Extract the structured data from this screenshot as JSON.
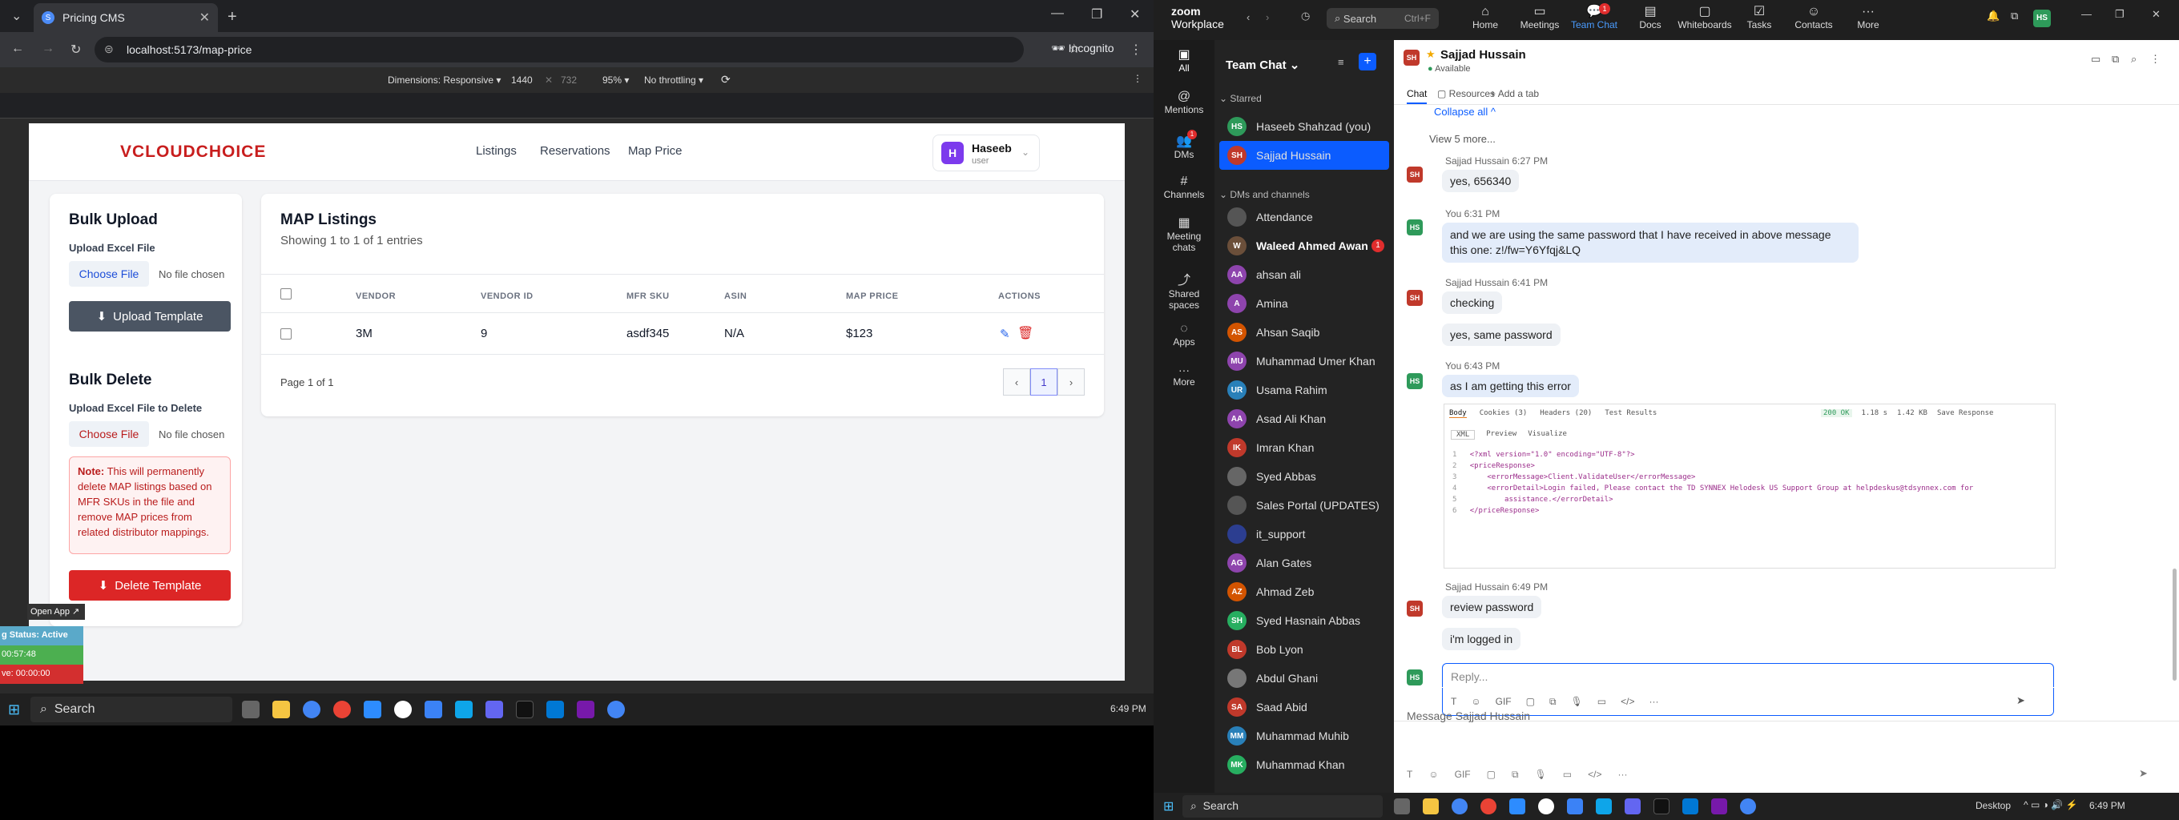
{
  "browser": {
    "tab_title": "Pricing CMS",
    "url": "localhost:5173/map-price",
    "incognito_label": "Incognito",
    "devtools": {
      "dimensions_label": "Dimensions: Responsive",
      "width": "1440",
      "height": "732",
      "zoom": "95%",
      "throttling": "No throttling"
    }
  },
  "app": {
    "logo_text": "CLOUDCHOICE",
    "nav": [
      "Listings",
      "Reservations",
      "Map Price"
    ],
    "user": {
      "initial": "H",
      "name": "Haseeb",
      "role": "user"
    },
    "bulk_upload": {
      "title": "Bulk Upload",
      "label": "Upload Excel File",
      "choose_label": "Choose File",
      "no_file": "No file chosen",
      "button": "Upload Template"
    },
    "bulk_delete": {
      "title": "Bulk Delete",
      "label": "Upload Excel File to Delete",
      "choose_label": "Choose File",
      "no_file": "No file chosen",
      "note_strong": "Note:",
      "note_text": " This will permanently delete MAP listings based on MFR SKUs in the file and remove MAP prices from related distributor mappings.",
      "button": "Delete Template"
    },
    "listings": {
      "title": "MAP Listings",
      "subtitle": "Showing 1 to 1 of 1 entries",
      "columns": [
        "VENDOR",
        "VENDOR ID",
        "MFR SKU",
        "ASIN",
        "MAP PRICE",
        "ACTIONS"
      ],
      "rows": [
        {
          "vendor": "3M",
          "vendor_id": "9",
          "mfr_sku": "asdf345",
          "asin": "N/A",
          "map_price": "$123"
        }
      ],
      "page_info": "Page 1 of 1",
      "current_page": "1"
    }
  },
  "widget": {
    "open_app": "Open App ↗",
    "status": "g Status: Active",
    "timer": "00:57:48",
    "ive": "ve: 00:00:00"
  },
  "taskbar_left": {
    "search": "Search",
    "time": "6:49 PM"
  },
  "zoom": {
    "brand_top": "zoom",
    "brand_bottom": "Workplace",
    "search": "Search",
    "shortcut": "Ctrl+F",
    "menu": [
      "Home",
      "Meetings",
      "Team Chat",
      "Docs",
      "Whiteboards",
      "Tasks",
      "Contacts",
      "More"
    ],
    "team_chat_badge": "1",
    "my_initials": "HS",
    "rail": [
      "All",
      "Mentions",
      "DMs",
      "Channels",
      "Meeting chats",
      "Shared spaces",
      "Apps",
      "More"
    ],
    "dms_badge": "1",
    "sidebar_title": "Team Chat",
    "starred_label": "Starred",
    "starred": [
      {
        "initials": "HS",
        "name": "Haseeb Shahzad (you)",
        "color": "#2e9a5a"
      },
      {
        "initials": "SH",
        "name": "Sajjad Hussain",
        "color": "#c0392b",
        "selected": true
      }
    ],
    "dms_label": "DMs and channels",
    "dms": [
      {
        "initials": "",
        "name": "Attendance",
        "color": "#555"
      },
      {
        "initials": "W",
        "name": "Waleed Ahmed Awan",
        "color": "#6b4f3a",
        "bold": true,
        "badge": "1"
      },
      {
        "initials": "AA",
        "name": "ahsan ali",
        "color": "#8e44ad"
      },
      {
        "initials": "A",
        "name": "Amina",
        "color": "#8e44ad"
      },
      {
        "initials": "AS",
        "name": "Ahsan Saqib",
        "color": "#d35400"
      },
      {
        "initials": "MU",
        "name": "Muhammad Umer Khan",
        "color": "#8e44ad"
      },
      {
        "initials": "UR",
        "name": "Usama Rahim",
        "color": "#2980b9"
      },
      {
        "initials": "AA",
        "name": "Asad Ali Khan",
        "color": "#8e44ad"
      },
      {
        "initials": "IK",
        "name": "Imran Khan",
        "color": "#c0392b"
      },
      {
        "initials": "",
        "name": "Syed Abbas",
        "color": "#666"
      },
      {
        "initials": "",
        "name": "Sales Portal (UPDATES)",
        "color": "#555"
      },
      {
        "initials": "",
        "name": "it_support",
        "color": "#2c3e90"
      },
      {
        "initials": "AG",
        "name": "Alan Gates",
        "color": "#8e44ad"
      },
      {
        "initials": "AZ",
        "name": "Ahmad Zeb",
        "color": "#d35400"
      },
      {
        "initials": "SH",
        "name": "Syed Hasnain Abbas",
        "color": "#27ae60"
      },
      {
        "initials": "BL",
        "name": "Bob Lyon",
        "color": "#c0392b"
      },
      {
        "initials": "",
        "name": "Abdul Ghani",
        "color": "#777"
      },
      {
        "initials": "SA",
        "name": "Saad Abid",
        "color": "#c0392b"
      },
      {
        "initials": "MM",
        "name": "Muhammad Muhib",
        "color": "#2980b9"
      },
      {
        "initials": "MK",
        "name": "Muhammad Khan",
        "color": "#27ae60"
      }
    ],
    "chat": {
      "contact": "Sajjad Hussain",
      "contact_initials": "SH",
      "status": "Available",
      "tabs": [
        "Chat",
        "Resources",
        "Add a tab"
      ],
      "collapse": "Collapse all",
      "view_more": "View 5 more...",
      "messages": [
        {
          "who": "SH",
          "meta": "Sajjad Hussain 6:27 PM",
          "lines": [
            "yes, 656340"
          ]
        },
        {
          "who": "HS",
          "meta": "You 6:31 PM",
          "lines": [
            "and we are using the same password that I have received in above message this one: z!/fw=Y6Yfqj&LQ"
          ]
        },
        {
          "who": "SH",
          "meta": "Sajjad Hussain 6:41 PM",
          "lines": [
            "checking",
            "yes, same password"
          ]
        },
        {
          "who": "HS",
          "meta": "You 6:43 PM",
          "lines": [
            "as I am getting this error"
          ]
        },
        {
          "who": "SH",
          "meta": "Sajjad Hussain 6:49 PM",
          "lines": [
            "review password",
            "i'm logged in"
          ]
        }
      ],
      "shot": {
        "tabs": [
          "Body",
          "Cookies (3)",
          "Headers (20)",
          "Test Results"
        ],
        "status": "200 OK",
        "time": "1.18 s",
        "size": "1.42 KB",
        "save": "Save Response",
        "format": "XML",
        "preview": "Preview",
        "visualize": "Visualize",
        "code": [
          "<?xml version=\"1.0\" encoding=\"UTF-8\"?>",
          "<priceResponse>",
          "    <errorMessage>Client.ValidateUser</errorMessage>",
          "    <errorDetail>Login failed, Please contact the TD SYNNEX Helodesk US Support Group at helpdeskus@tdsynnex.com for",
          "        assistance.</errorDetail>",
          "</priceResponse>"
        ]
      },
      "reply_placeholder": "Reply...",
      "message_placeholder": "Message Sajjad Hussain"
    }
  },
  "taskbar_right": {
    "search": "Search",
    "desktop": "Desktop",
    "time": "6:49 PM"
  }
}
